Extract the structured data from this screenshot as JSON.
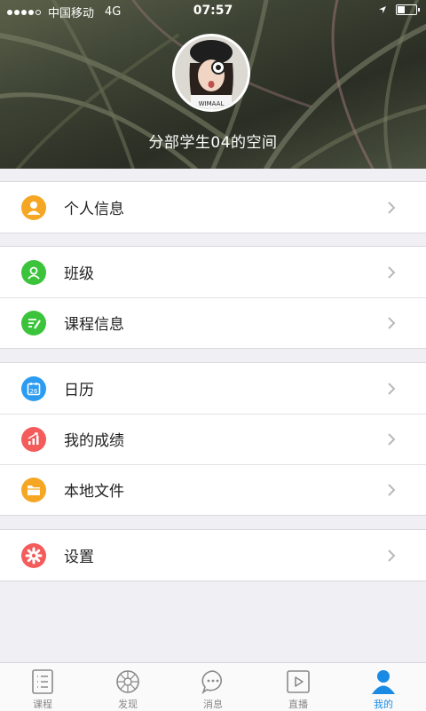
{
  "status_bar": {
    "carrier": "中国移动",
    "network": "4G",
    "time": "07:57"
  },
  "profile": {
    "space_title": "分部学生04的空间",
    "avatar_icon": "user-photo"
  },
  "menu": {
    "groups": [
      [
        {
          "label": "个人信息",
          "icon": "person-icon",
          "color": "#f5a623"
        }
      ],
      [
        {
          "label": "班级",
          "icon": "class-icon",
          "color": "#3bc43b"
        },
        {
          "label": "课程信息",
          "icon": "course-info-icon",
          "color": "#3bc43b"
        }
      ],
      [
        {
          "label": "日历",
          "icon": "calendar-icon",
          "color": "#2b9cf2",
          "badge": "26"
        },
        {
          "label": "我的成绩",
          "icon": "grades-icon",
          "color": "#f45c5c"
        },
        {
          "label": "本地文件",
          "icon": "folder-icon",
          "color": "#f5a623"
        }
      ],
      [
        {
          "label": "设置",
          "icon": "gear-icon",
          "color": "#f45c5c"
        }
      ]
    ]
  },
  "tabbar": {
    "tabs": [
      {
        "label": "课程",
        "icon": "list-icon"
      },
      {
        "label": "发现",
        "icon": "compass-icon"
      },
      {
        "label": "消息",
        "icon": "chat-icon"
      },
      {
        "label": "直播",
        "icon": "play-icon"
      },
      {
        "label": "我的",
        "icon": "person-icon",
        "active": true
      }
    ],
    "active_color": "#1a8be4"
  }
}
